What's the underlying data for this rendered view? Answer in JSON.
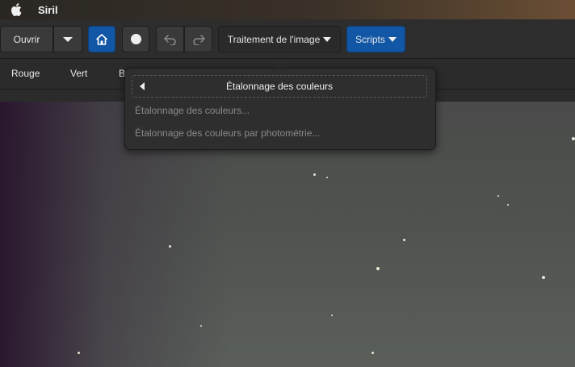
{
  "menubar": {
    "app_name": "Siril",
    "apple_icon": "apple-icon"
  },
  "toolbar": {
    "open_label": "Ouvrir",
    "open_menu_icon": "chevron-down-icon",
    "home_icon": "home-icon",
    "live_icon": "circle-icon",
    "undo_icon": "undo-icon",
    "redo_icon": "redo-icon",
    "processing_label": "Traitement de l'image",
    "scripts_label": "Scripts"
  },
  "tabs": [
    {
      "label": "Rouge"
    },
    {
      "label": "Vert"
    },
    {
      "label": "Bl"
    }
  ],
  "popover": {
    "header": "Étalonnage des couleurs",
    "items": [
      {
        "label": "Étalonnage des couleurs..."
      },
      {
        "label": "Étalonnage des couleurs par photométrie..."
      }
    ]
  },
  "colors": {
    "accent_blue": "#1157a6",
    "toolbar_bg": "#2d2d2d",
    "popover_bg": "#2e2e2e",
    "disabled_text": "#8a8a8a"
  }
}
